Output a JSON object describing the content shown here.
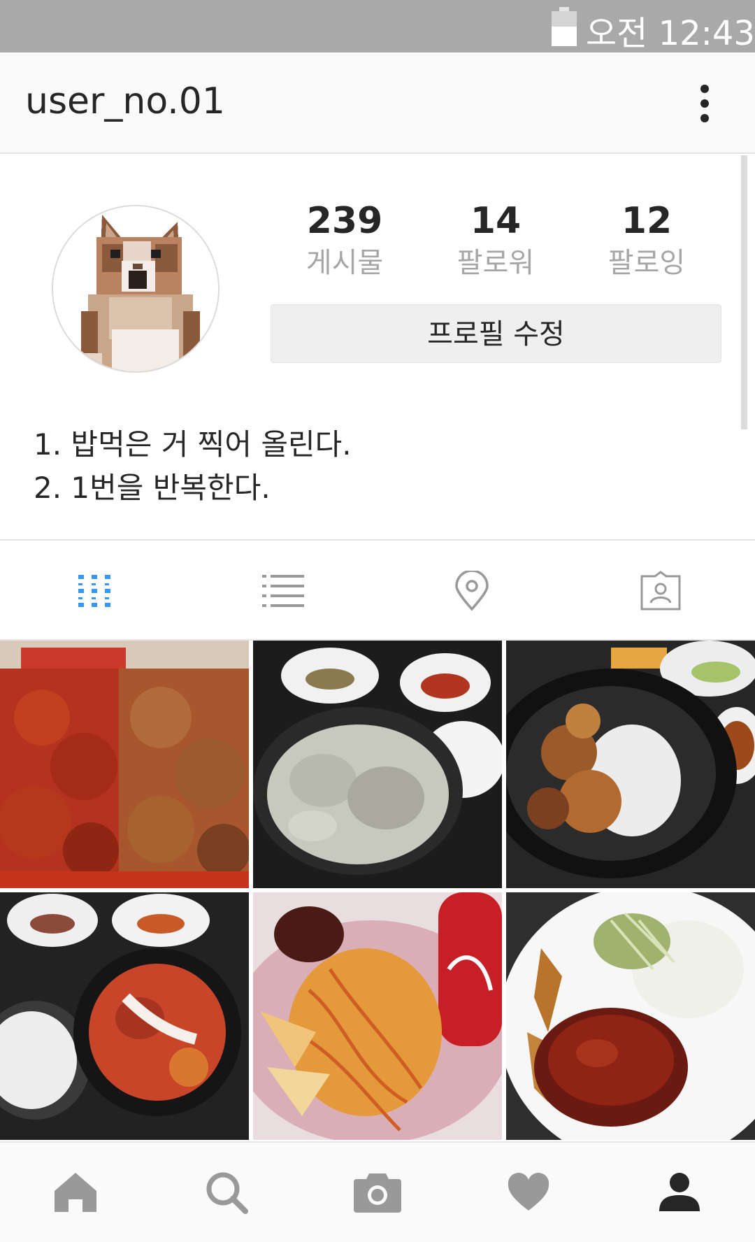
{
  "status_bar": {
    "time": "오전 12:43",
    "battery_icon": "battery-icon"
  },
  "app_bar": {
    "username": "user_no.01",
    "more_icon": "more-vertical-icon"
  },
  "profile": {
    "stats": [
      {
        "value": "239",
        "label": "게시물"
      },
      {
        "value": "14",
        "label": "팔로워"
      },
      {
        "value": "12",
        "label": "팔로잉"
      }
    ],
    "edit_button": "프로필 수정",
    "bio": [
      "1. 밥먹은 거 찍어 올린다.",
      "2. 1번을 반복한다."
    ]
  },
  "tabs": [
    {
      "icon": "grid-icon",
      "active": true
    },
    {
      "icon": "list-icon",
      "active": false
    },
    {
      "icon": "location-pin-icon",
      "active": false
    },
    {
      "icon": "tagged-photos-icon",
      "active": false
    }
  ],
  "posts": [
    {
      "subject": "fried-chicken-photo"
    },
    {
      "subject": "dumpling-soup-photo"
    },
    {
      "subject": "stir-fry-rice-photo"
    },
    {
      "subject": "stew-rice-photo"
    },
    {
      "subject": "spaghetti-photo"
    },
    {
      "subject": "pork-cutlet-photo"
    }
  ],
  "bottom_nav": [
    {
      "icon": "home-icon"
    },
    {
      "icon": "search-icon"
    },
    {
      "icon": "camera-icon"
    },
    {
      "icon": "heart-icon"
    },
    {
      "icon": "profile-icon",
      "active": true
    }
  ],
  "colors": {
    "accent": "#3897f0",
    "status_bar": "#a9a9a9",
    "inactive_icon": "#999999",
    "text": "#262626",
    "muted_text": "#a6a6a6"
  }
}
